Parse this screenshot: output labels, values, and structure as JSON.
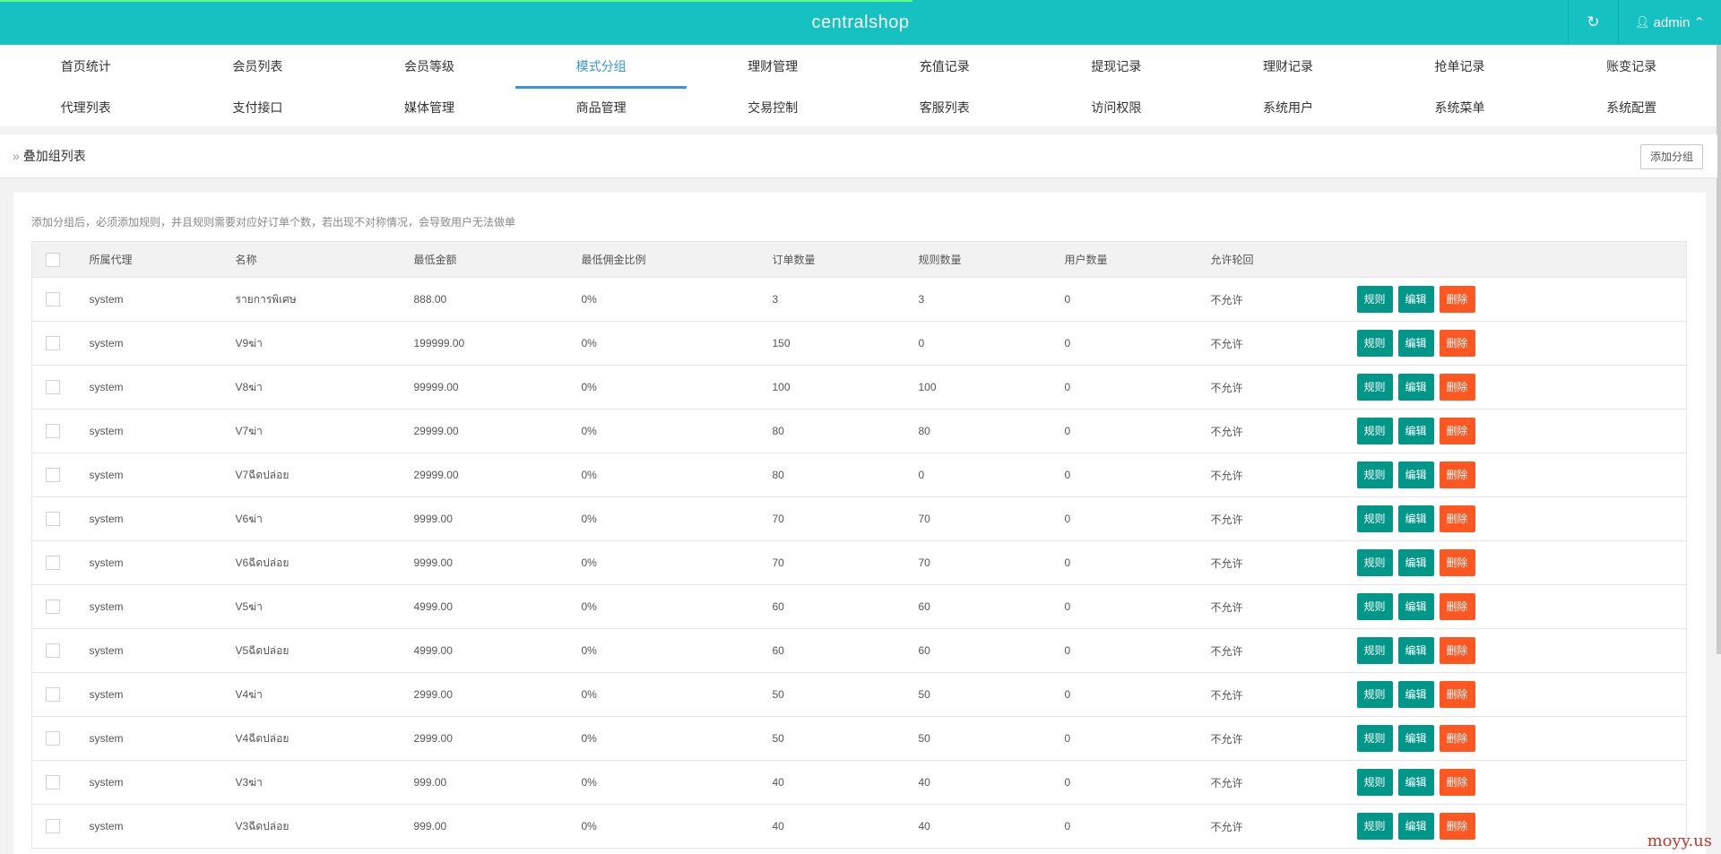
{
  "app": {
    "title": "centralshop",
    "user": "admin"
  },
  "nav": {
    "row1": [
      "首页统计",
      "会员列表",
      "会员等级",
      "模式分组",
      "理财管理",
      "充值记录",
      "提现记录",
      "理财记录",
      "抢单记录",
      "账变记录"
    ],
    "row2": [
      "代理列表",
      "支付接口",
      "媒体管理",
      "商品管理",
      "交易控制",
      "客服列表",
      "访问权限",
      "系统用户",
      "系统菜单",
      "系统配置"
    ],
    "active": "模式分组"
  },
  "breadcrumb": {
    "title": "叠加组列表",
    "add_button": "添加分组"
  },
  "tip": "添加分组后，必须添加规则，并且规则需要对应好订单个数，若出现不对称情况，会导致用户无法做单",
  "table": {
    "headers": [
      "所属代理",
      "名称",
      "最低金额",
      "最低佣金比例",
      "订单数量",
      "规则数量",
      "用户数量",
      "允许轮回"
    ],
    "actions": {
      "rule": "规则",
      "edit": "编辑",
      "delete": "删除"
    },
    "rows": [
      [
        "system",
        "รายการพิเศษ",
        "888.00",
        "0%",
        "3",
        "3",
        "0",
        "不允许"
      ],
      [
        "system",
        "V9ฆ่า",
        "199999.00",
        "0%",
        "150",
        "0",
        "0",
        "不允许"
      ],
      [
        "system",
        "V8ฆ่า",
        "99999.00",
        "0%",
        "100",
        "100",
        "0",
        "不允许"
      ],
      [
        "system",
        "V7ฆ่า",
        "29999.00",
        "0%",
        "80",
        "80",
        "0",
        "不允许"
      ],
      [
        "system",
        "V7ฉีดปล่อย",
        "29999.00",
        "0%",
        "80",
        "0",
        "0",
        "不允许"
      ],
      [
        "system",
        "V6ฆ่า",
        "9999.00",
        "0%",
        "70",
        "70",
        "0",
        "不允许"
      ],
      [
        "system",
        "V6ฉีดปล่อย",
        "9999.00",
        "0%",
        "70",
        "70",
        "0",
        "不允许"
      ],
      [
        "system",
        "V5ฆ่า",
        "4999.00",
        "0%",
        "60",
        "60",
        "0",
        "不允许"
      ],
      [
        "system",
        "V5ฉีดปล่อย",
        "4999.00",
        "0%",
        "60",
        "60",
        "0",
        "不允许"
      ],
      [
        "system",
        "V4ฆ่า",
        "2999.00",
        "0%",
        "50",
        "50",
        "0",
        "不允许"
      ],
      [
        "system",
        "V4ฉีดปล่อย",
        "2999.00",
        "0%",
        "50",
        "50",
        "0",
        "不允许"
      ],
      [
        "system",
        "V3ฆ่า",
        "999.00",
        "0%",
        "40",
        "40",
        "0",
        "不允许"
      ],
      [
        "system",
        "V3ฉีดปล่อย",
        "999.00",
        "0%",
        "40",
        "40",
        "0",
        "不允许"
      ]
    ]
  },
  "watermark": "moyy.us",
  "colors": {
    "topbar": "#16c1c1",
    "active_tab": "#3a96d8",
    "btn_teal": "#009688",
    "btn_orange": "#ff5722"
  }
}
